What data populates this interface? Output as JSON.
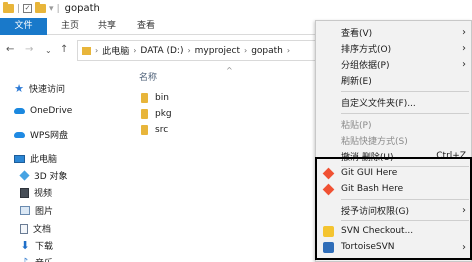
{
  "window": {
    "title": "gopath",
    "quick_access_separator": "|",
    "quick_access_check": "✓",
    "quick_access_dropdown": "▾"
  },
  "ribbon": {
    "tabs": [
      {
        "label": "文件"
      },
      {
        "label": "主页"
      },
      {
        "label": "共享"
      },
      {
        "label": "查看"
      }
    ]
  },
  "address": {
    "back": "←",
    "forward": "→",
    "recent": "⌄",
    "up": "↑",
    "separator": "›",
    "breadcrumbs": [
      "此电脑",
      "DATA (D:)",
      "myproject",
      "gopath"
    ]
  },
  "navigation": {
    "items": [
      {
        "label": "快速访问",
        "icon": "star-icon",
        "glyph": "★"
      },
      {
        "label": "OneDrive",
        "icon": "cloud-icon"
      },
      {
        "label": "WPS网盘",
        "icon": "wps-cloud-icon"
      },
      {
        "label": "此电脑",
        "icon": "computer-icon"
      },
      {
        "label": "3D 对象",
        "icon": "3d-objects-icon"
      },
      {
        "label": "视频",
        "icon": "video-icon"
      },
      {
        "label": "图片",
        "icon": "pictures-icon"
      },
      {
        "label": "文档",
        "icon": "documents-icon"
      },
      {
        "label": "下载",
        "icon": "download-icon",
        "glyph": "⬇"
      },
      {
        "label": "音乐",
        "icon": "music-icon",
        "glyph": "♪"
      }
    ]
  },
  "filelist": {
    "column_name": "名称",
    "sort_indicator": "^",
    "files": [
      {
        "name": "bin"
      },
      {
        "name": "pkg"
      },
      {
        "name": "src"
      }
    ]
  },
  "context_menu": {
    "items": [
      {
        "label": "查看(V)",
        "submenu": true
      },
      {
        "label": "排序方式(O)",
        "submenu": true
      },
      {
        "label": "分组依据(P)",
        "submenu": true
      },
      {
        "label": "刷新(E)"
      },
      {
        "label": "自定义文件夹(F)..."
      },
      {
        "label": "粘贴(P)",
        "disabled": true
      },
      {
        "label": "粘贴快捷方式(S)",
        "disabled": true
      },
      {
        "label": "撤消 删除(U)",
        "shortcut": "Ctrl+Z"
      },
      {
        "label": "Git GUI Here",
        "icon": "git-gui-icon"
      },
      {
        "label": "Git Bash Here",
        "icon": "git-bash-icon"
      },
      {
        "label": "授予访问权限(G)",
        "submenu": true
      },
      {
        "label": "SVN Checkout...",
        "icon": "svn-checkout-icon"
      },
      {
        "label": "TortoiseSVN",
        "icon": "tortoisesvn-icon",
        "submenu": true
      }
    ],
    "submenu_arrow": "›"
  },
  "colors": {
    "file_tab_bg": "#1979ca",
    "folder": "#e8b53a",
    "menu_bg": "#f2f2f2",
    "highlight_border": "#000000"
  }
}
